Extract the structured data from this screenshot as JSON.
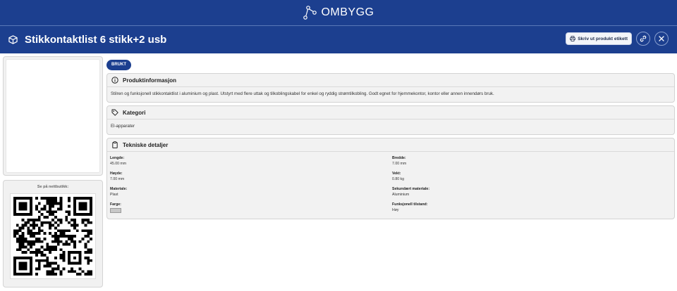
{
  "brand": {
    "name": "OMBYGG",
    "logo_icon": "network-nodes-icon"
  },
  "product": {
    "title": "Stikkontaktlist 6 stikk+2 usb",
    "title_icon": "box-icon"
  },
  "actions": {
    "print_label": "Skriv ut produkt etikett",
    "print_icon": "printer-icon",
    "link_icon": "link-icon",
    "close_icon": "close-icon"
  },
  "condition_badge": "BRUKT",
  "info": {
    "heading": "Produktinformasjon",
    "icon": "info-icon",
    "description": "Stilren og funksjonell stikkontaktlist i aluminium og plast. Utstyrt med flere uttak og tilkoblingskabel for enkel og ryddig strømtilkobling. Godt egnet for hjemmekontor, kontor eller annen innendørs bruk."
  },
  "category": {
    "heading": "Kategori",
    "icon": "tag-icon",
    "value": "El-apparater"
  },
  "details": {
    "heading": "Tekniske detaljer",
    "icon": "clipboard-icon",
    "length": {
      "label": "Lengde:",
      "value": "45.00 mm"
    },
    "width": {
      "label": "Bredde:",
      "value": "7.00 mm"
    },
    "height": {
      "label": "Høyde:",
      "value": "7.00 mm"
    },
    "weight": {
      "label": "Vekt:",
      "value": "0.80 kg"
    },
    "material": {
      "label": "Materiale:",
      "value": "Plast"
    },
    "secondary_material": {
      "label": "Sekundært materiale:",
      "value": "Aluminium"
    },
    "color": {
      "label": "Farge:",
      "swatch": "#c8c8c8"
    },
    "condition": {
      "label": "Funksjonell tilstand:",
      "value": "Høy"
    }
  },
  "qr": {
    "label": "Se på nettbutikk:"
  },
  "colors": {
    "primary": "#1c3f8f",
    "card_bg": "#f2f2f2"
  }
}
